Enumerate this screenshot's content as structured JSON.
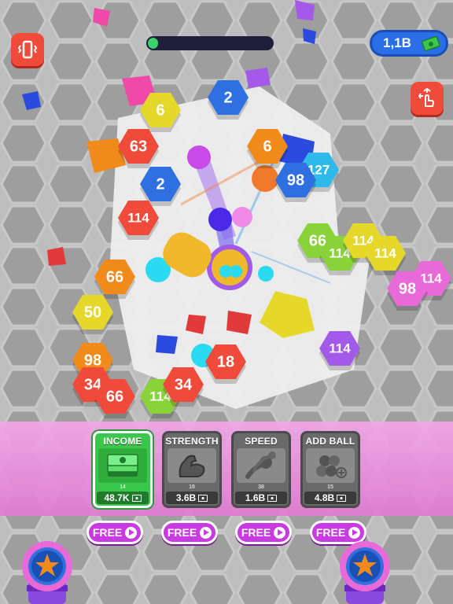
{
  "hud": {
    "vibration_icon": "phone-vibrate-icon",
    "drag_icon": "drag-hand-icon",
    "level_progress": 0.08,
    "currency_value": "1,1B",
    "currency_icon": "cash-stack-icon"
  },
  "blocks": [
    {
      "value": "2",
      "color": "#2f6fe0"
    },
    {
      "value": "2",
      "color": "#2f6fe0"
    },
    {
      "value": "63",
      "color": "#f04a3a"
    },
    {
      "value": "6",
      "color": "#f08a1a"
    },
    {
      "value": "127",
      "color": "#2fb8ea"
    },
    {
      "value": "98",
      "color": "#2f6fe0"
    },
    {
      "value": "114",
      "color": "#f04a3a"
    },
    {
      "value": "66",
      "color": "#8ad23a"
    },
    {
      "value": "114",
      "color": "#8ad23a"
    },
    {
      "value": "114",
      "color": "#e6d82a"
    },
    {
      "value": "114",
      "color": "#e6d82a"
    },
    {
      "value": "114",
      "color": "#e86ad8"
    },
    {
      "value": "98",
      "color": "#e86ad8"
    },
    {
      "value": "66",
      "color": "#f08a1a"
    },
    {
      "value": "50",
      "color": "#e6d82a"
    },
    {
      "value": "114",
      "color": "#a35ae8"
    },
    {
      "value": "98",
      "color": "#f08a1a"
    },
    {
      "value": "34",
      "color": "#f04a3a"
    },
    {
      "value": "66",
      "color": "#f04a3a"
    },
    {
      "value": "114",
      "color": "#8ad23a"
    },
    {
      "value": "34",
      "color": "#f04a3a"
    },
    {
      "value": "18",
      "color": "#f04a3a"
    },
    {
      "value": "6",
      "color": "#e6d82a"
    }
  ],
  "upgrades": [
    {
      "title": "INCOME",
      "level": "14",
      "cost": "48.7K",
      "icon": "cash-stack-icon",
      "free_label": "FREE"
    },
    {
      "title": "STRENGTH",
      "level": "16",
      "cost": "3.6B",
      "icon": "flexed-arm-icon",
      "free_label": "FREE"
    },
    {
      "title": "SPEED",
      "level": "38",
      "cost": "1.6B",
      "icon": "speed-balls-icon",
      "free_label": "FREE"
    },
    {
      "title": "ADD BALL",
      "level": "15",
      "cost": "4.8B",
      "icon": "add-ball-icon",
      "free_label": "FREE"
    }
  ],
  "colors": {
    "accent_red": "#f04a3a",
    "currency_blue": "#2a6ee8",
    "free_button": "#c93ae0",
    "panel_pink": "#e17ad3",
    "income_green": "#3ac84c"
  }
}
